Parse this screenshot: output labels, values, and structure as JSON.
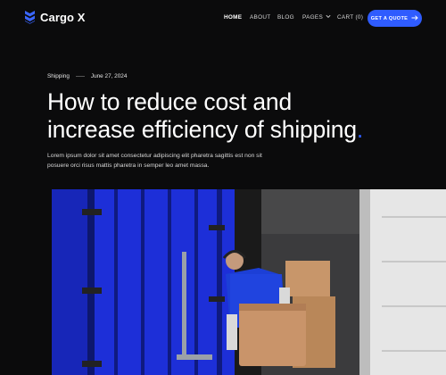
{
  "brand": {
    "name": "Cargo X",
    "logo_icon": "chevrons-logo-icon",
    "accent": "#2f5cff"
  },
  "nav": {
    "items": [
      {
        "label": "HOME",
        "active": true
      },
      {
        "label": "ABOUT",
        "active": false
      },
      {
        "label": "BLOG",
        "active": false
      },
      {
        "label": "PAGES",
        "active": false
      },
      {
        "label": "CART (0)",
        "active": false
      }
    ],
    "cta": {
      "label": "GET A QUOTE",
      "icon": "arrow-right-icon"
    }
  },
  "article": {
    "category": "Shipping",
    "date": "June 27, 2024",
    "title_line1": "How to reduce cost and",
    "title_line2": "increase efficiency of shipping",
    "title_dot": ".",
    "description": "Lorem ipsum dolor sit amet consectetur adipiscing elit pharetra sagittis est non sit posuere orci risus mattis pharetra in semper leo amet massa."
  }
}
